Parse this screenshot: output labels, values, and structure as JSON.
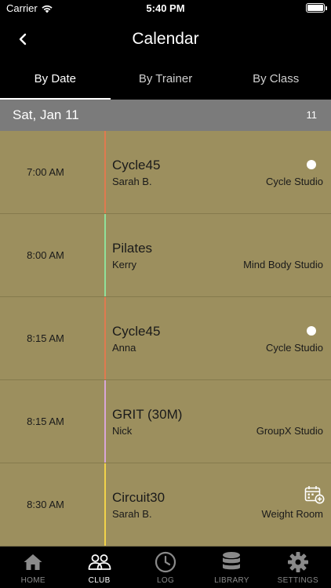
{
  "status_bar": {
    "carrier": "Carrier",
    "time": "5:40 PM"
  },
  "nav": {
    "title": "Calendar"
  },
  "tabs": [
    {
      "label": "By Date",
      "active": true
    },
    {
      "label": "By Trainer",
      "active": false
    },
    {
      "label": "By Class",
      "active": false
    }
  ],
  "date_header": {
    "label": "Sat, Jan 11",
    "count": "11"
  },
  "classes": [
    {
      "time": "7:00 AM",
      "name": "Cycle45",
      "trainer": "Sarah B.",
      "room": "Cycle Studio",
      "color": "#e07a4f",
      "indicator": "dot"
    },
    {
      "time": "8:00 AM",
      "name": "Pilates",
      "trainer": "Kerry",
      "room": "Mind Body Studio",
      "color": "#8fe09a",
      "indicator": "none"
    },
    {
      "time": "8:15 AM",
      "name": "Cycle45",
      "trainer": "Anna",
      "room": "Cycle Studio",
      "color": "#e07a4f",
      "indicator": "dot"
    },
    {
      "time": "8:15 AM",
      "name": "GRIT (30M)",
      "trainer": "Nick",
      "room": "GroupX Studio",
      "color": "#d8a6d8",
      "indicator": "none"
    },
    {
      "time": "8:30 AM",
      "name": "Circuit30",
      "trainer": "Sarah B.",
      "room": "Weight Room",
      "color": "#f2d24a",
      "indicator": "calendar-add"
    }
  ],
  "tab_bar": [
    {
      "label": "HOME",
      "icon": "home-icon",
      "active": false
    },
    {
      "label": "CLUB",
      "icon": "club-icon",
      "active": true
    },
    {
      "label": "LOG",
      "icon": "clock-icon",
      "active": false
    },
    {
      "label": "LIBRARY",
      "icon": "database-icon",
      "active": false
    },
    {
      "label": "SETTINGS",
      "icon": "gear-icon",
      "active": false
    }
  ]
}
